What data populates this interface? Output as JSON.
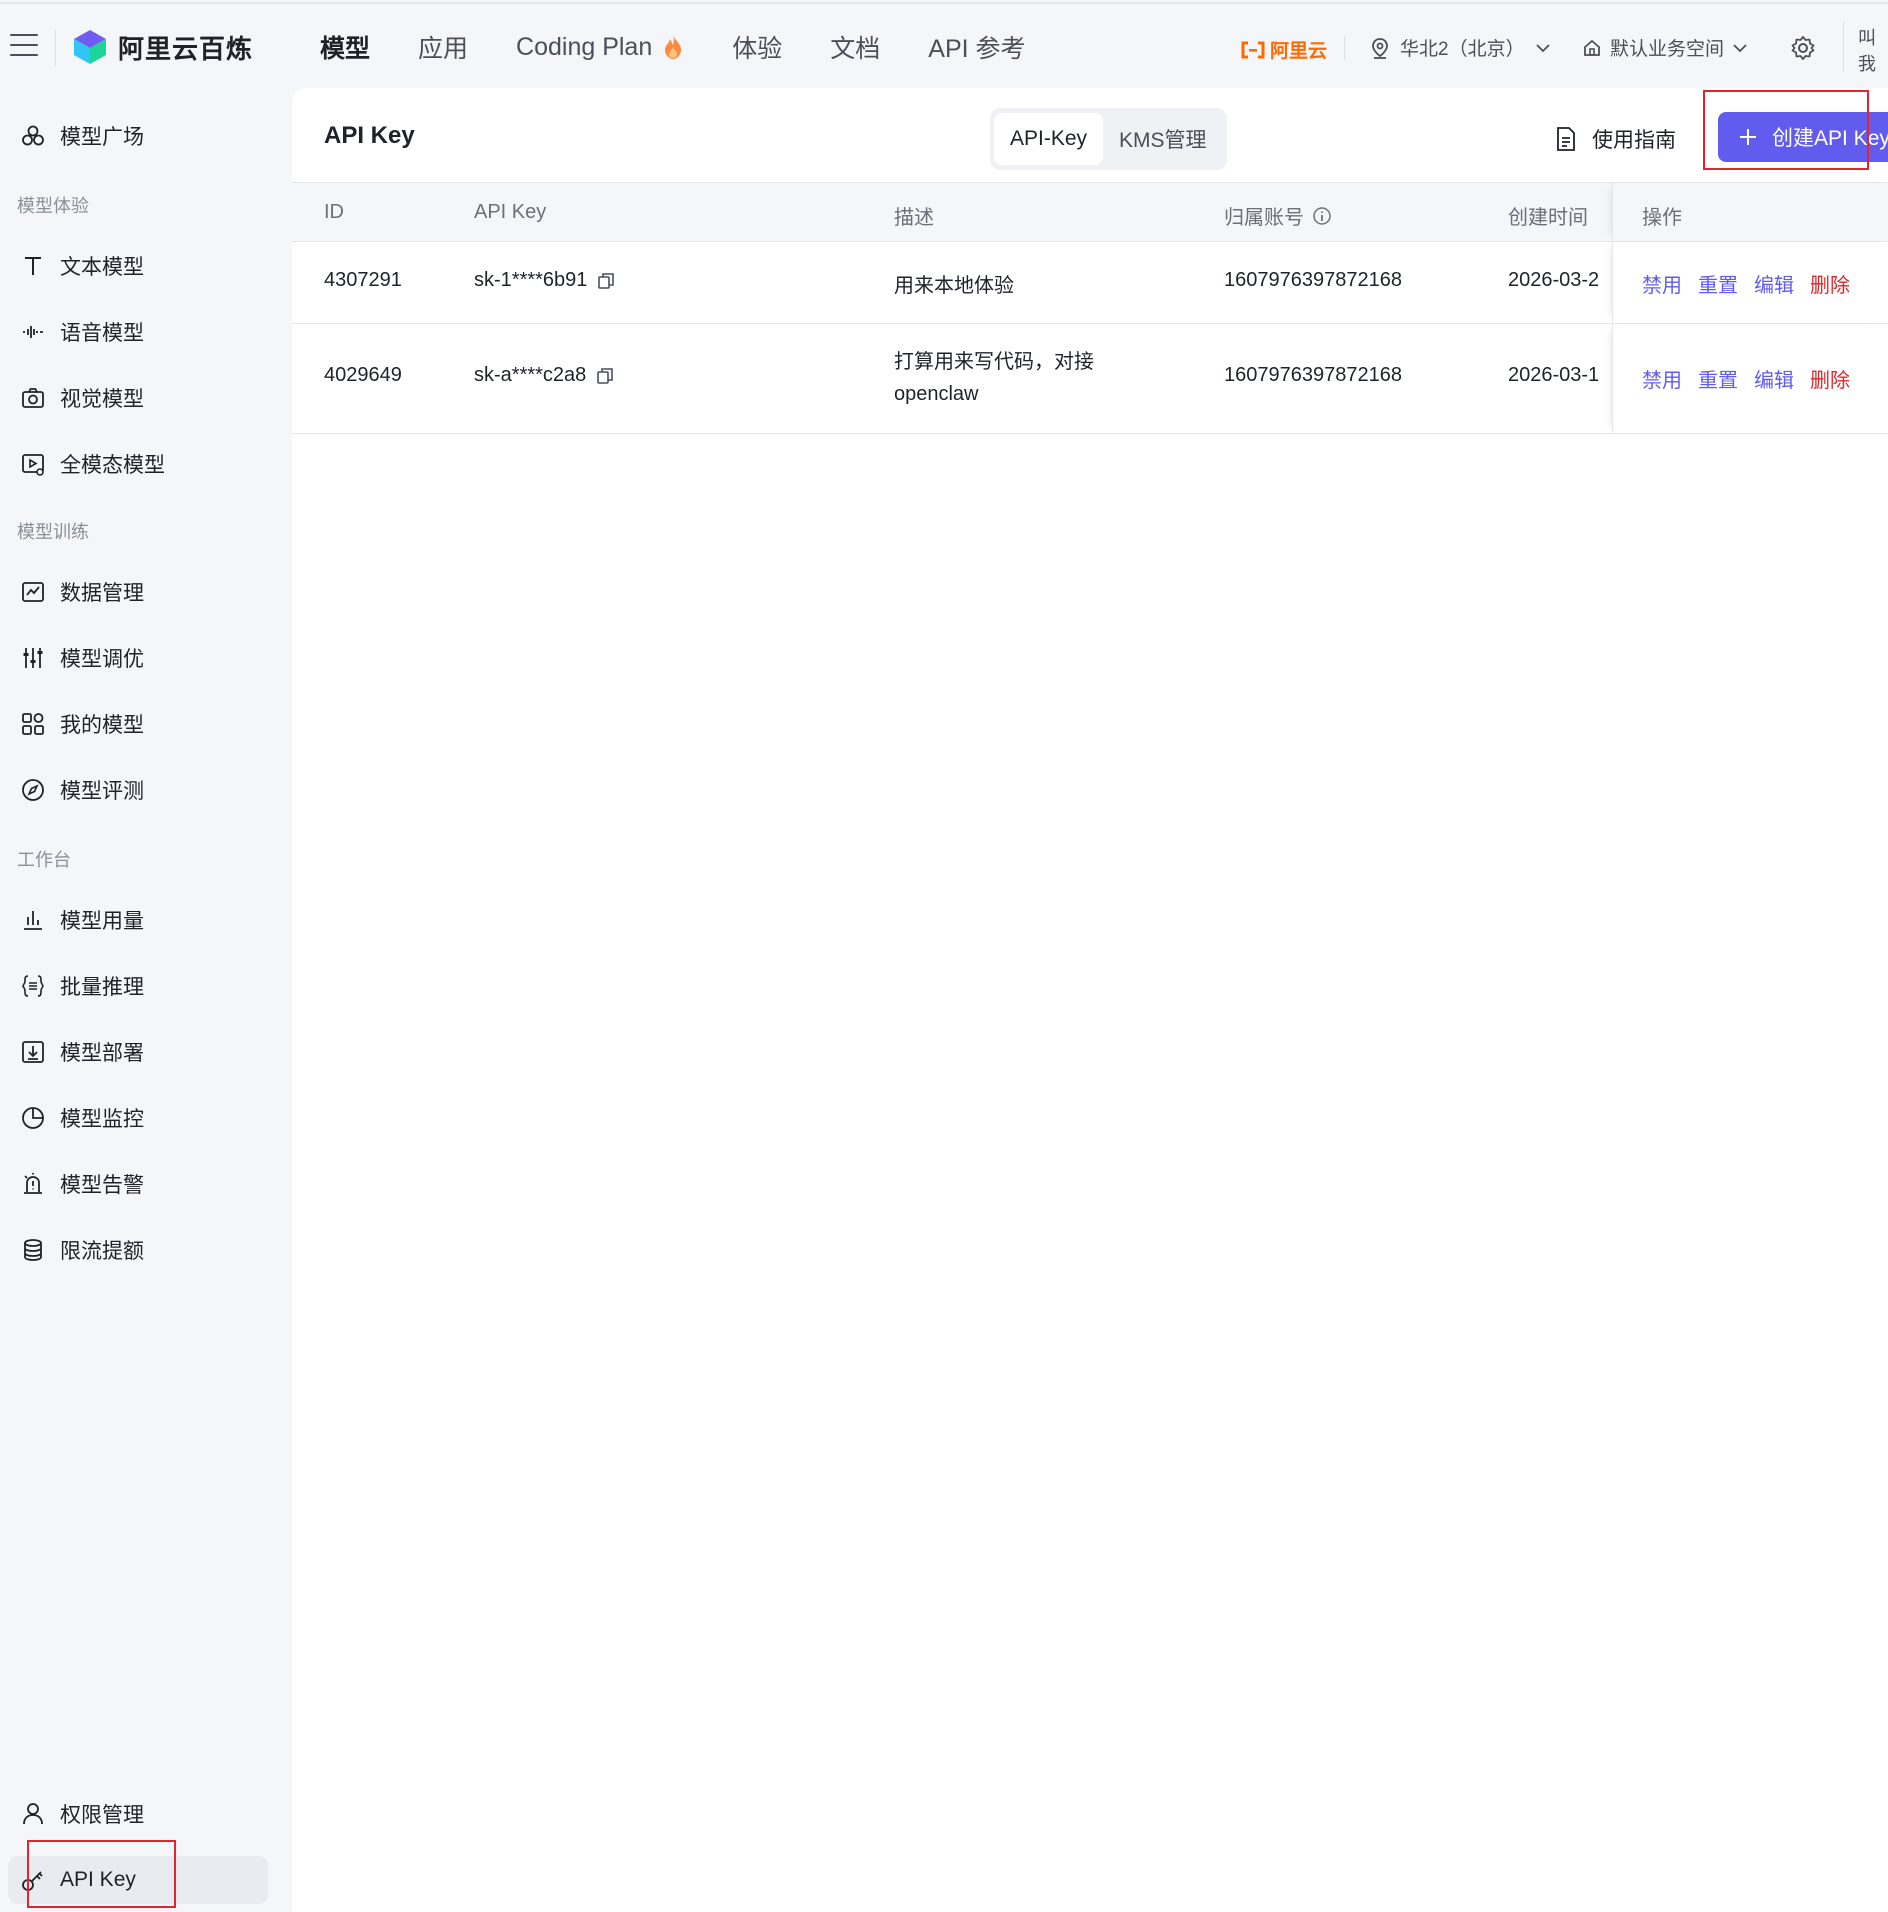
{
  "topbar": {
    "brand": "阿里云百炼",
    "nav": [
      {
        "label": "模型",
        "active": true
      },
      {
        "label": "应用",
        "active": false
      },
      {
        "label": "Coding Plan",
        "active": false,
        "icon": "flame-icon"
      },
      {
        "label": "体验",
        "active": false
      },
      {
        "label": "文档",
        "active": false
      },
      {
        "label": "API 参考",
        "active": false
      }
    ],
    "aliyun_logo": "阿里云",
    "region": "华北2（北京）",
    "workspace": "默认业务空间",
    "user": "叫我"
  },
  "sidebar": {
    "items_top": [
      {
        "label": "模型广场",
        "icon": "model-plaza-icon"
      }
    ],
    "groups": [
      {
        "title": "模型体验",
        "items": [
          {
            "label": "文本模型",
            "icon": "text-icon"
          },
          {
            "label": "语音模型",
            "icon": "audio-wave-icon"
          },
          {
            "label": "视觉模型",
            "icon": "camera-icon"
          },
          {
            "label": "全模态模型",
            "icon": "omni-modal-icon"
          }
        ]
      },
      {
        "title": "模型训练",
        "items": [
          {
            "label": "数据管理",
            "icon": "data-chart-icon"
          },
          {
            "label": "模型调优",
            "icon": "sliders-icon"
          },
          {
            "label": "我的模型",
            "icon": "apps-icon"
          },
          {
            "label": "模型评测",
            "icon": "compass-icon"
          }
        ]
      },
      {
        "title": "工作台",
        "items": [
          {
            "label": "模型用量",
            "icon": "bar-chart-icon"
          },
          {
            "label": "批量推理",
            "icon": "braces-icon"
          },
          {
            "label": "模型部署",
            "icon": "deploy-icon"
          },
          {
            "label": "模型监控",
            "icon": "pie-chart-icon"
          },
          {
            "label": "模型告警",
            "icon": "alarm-icon"
          },
          {
            "label": "限流提额",
            "icon": "database-icon"
          }
        ]
      }
    ],
    "items_bottom": [
      {
        "label": "权限管理",
        "icon": "user-icon"
      },
      {
        "label": "API Key",
        "icon": "key-icon",
        "active": true
      }
    ]
  },
  "page": {
    "title": "API Key",
    "tabs": [
      {
        "label": "API-Key",
        "active": true
      },
      {
        "label": "KMS管理",
        "active": false
      }
    ],
    "guide_label": "使用指南",
    "create_label": "创建API Key"
  },
  "table": {
    "columns": [
      "ID",
      "API Key",
      "描述",
      "归属账号",
      "创建时间",
      "操作"
    ],
    "rows": [
      {
        "id": "4307291",
        "key": "sk-1****6b91",
        "desc": "用来本地体验",
        "account": "1607976397872168",
        "created": "2026-03-2",
        "actions": [
          "禁用",
          "重置",
          "编辑",
          "删除"
        ]
      },
      {
        "id": "4029649",
        "key": "sk-a****c2a8",
        "desc": "打算用来写代码，对接openclaw",
        "account": "1607976397872168",
        "created": "2026-03-1",
        "actions": [
          "禁用",
          "重置",
          "编辑",
          "删除"
        ]
      }
    ]
  },
  "colors": {
    "accent": "#615ced",
    "danger": "#e0262a",
    "brand_orange": "#ff6a00"
  }
}
